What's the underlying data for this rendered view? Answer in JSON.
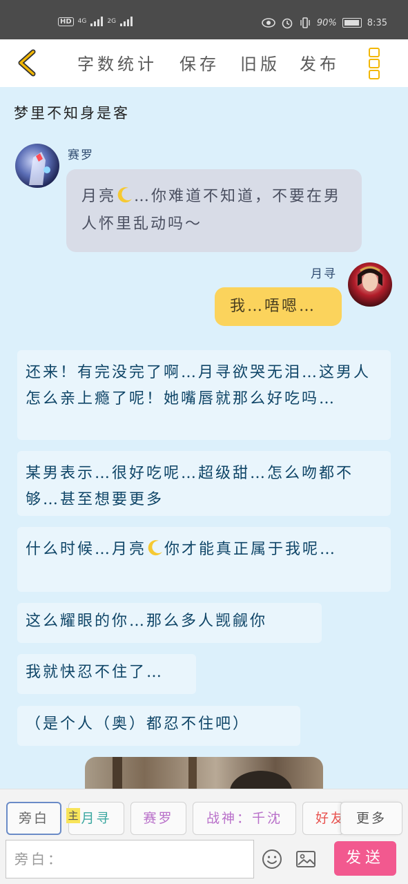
{
  "status_bar": {
    "left_badges": [
      "HD",
      "4G",
      "2G"
    ],
    "battery": "90%",
    "time": "8:35"
  },
  "header": {
    "nav": [
      "字数统计",
      "保存",
      "旧版",
      "发布"
    ],
    "icons": [
      "back-icon",
      "more-icon"
    ]
  },
  "story": {
    "title": "梦里不知身是客",
    "messages": [
      {
        "speaker": "赛罗",
        "text_a": "月亮",
        "text_b": "…你难道不知道，不要在男人怀里乱动吗～"
      },
      {
        "speaker": "月寻",
        "text": "我…唔嗯…"
      }
    ],
    "narrations": [
      "还来！有完没完了啊…月寻欲哭无泪…这男人怎么亲上瘾了呢！她嘴唇就那么好吃吗…",
      "某男表示…很好吃呢…超级甜…怎么吻都不够…甚至想要更多",
      {
        "a": "什么时候…月亮",
        "b": "你才能真正属于我呢…"
      },
      "这么耀眼的你…那么多人觊觎你",
      "我就快忍不住了…",
      "（是个人（奥）都忍不住吧）"
    ]
  },
  "roles": {
    "badge": "主",
    "items": [
      "旁白",
      "月寻",
      "赛罗",
      "战神：千沈",
      "好友",
      "更多"
    ],
    "colors": [
      "#666666",
      "#3aa7a0",
      "#b86fc9",
      "#b86fc9",
      "#e8524f",
      "#555555"
    ]
  },
  "composer": {
    "placeholder": "旁白：",
    "send_label": "发送"
  },
  "colors": {
    "accent_yellow": "#f2b705",
    "send_pink": "#f2598f",
    "narration_text": "#0f4567",
    "background": "#dcf0fb"
  }
}
